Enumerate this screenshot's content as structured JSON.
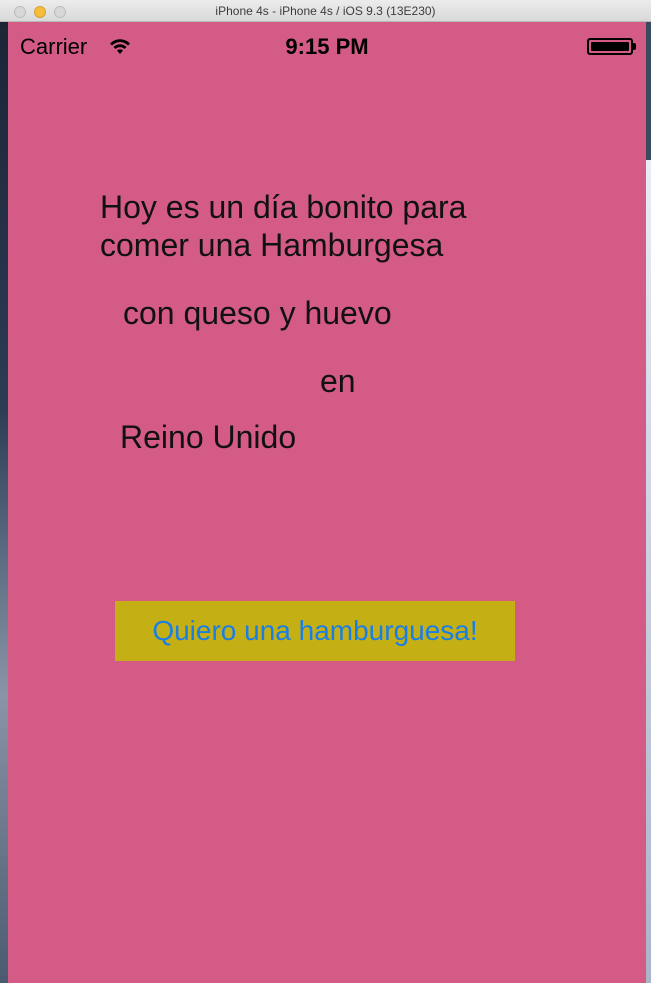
{
  "window": {
    "title": "iPhone 4s - iPhone 4s / iOS 9.3 (13E230)"
  },
  "statusbar": {
    "carrier": "Carrier",
    "time": "9:15 PM",
    "wifi_icon": "wifi-icon",
    "battery_icon": "battery-icon"
  },
  "content": {
    "heading_line_a": "Hoy es un día bonito para",
    "heading_line_b": "comer una Hamburgesa",
    "toppings": "con queso y huevo",
    "connector": "en",
    "country": "Reino Unido",
    "button_label": "Quiero una hamburguesa!"
  },
  "colors": {
    "background": "#d35b86",
    "button_background": "#c4b014",
    "button_text": "#1a7ee6"
  }
}
